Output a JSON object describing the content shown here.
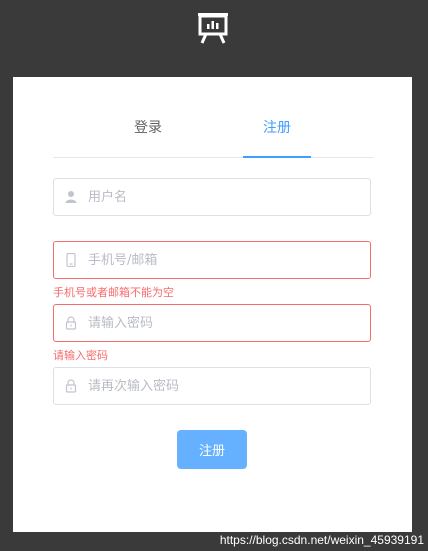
{
  "logo": {
    "icon": "presentation-board-icon"
  },
  "tabs": [
    {
      "label": "登录",
      "active": false
    },
    {
      "label": "注册",
      "active": true
    }
  ],
  "form": {
    "username": {
      "placeholder": "用户名",
      "value": "",
      "icon": "user-icon"
    },
    "contact": {
      "placeholder": "手机号/邮箱",
      "value": "",
      "icon": "phone-icon",
      "error": "手机号或者邮箱不能为空"
    },
    "password": {
      "placeholder": "请输入密码",
      "value": "",
      "icon": "lock-icon",
      "error": "请输入密码"
    },
    "confirm": {
      "placeholder": "请再次输入密码",
      "value": "",
      "icon": "lock-icon"
    },
    "submit_label": "注册"
  },
  "colors": {
    "accent": "#409eff",
    "button": "#66b1ff",
    "error": "#f56c6c",
    "background": "#3a3a3a"
  },
  "watermark": "https://blog.csdn.net/weixin_45939191"
}
